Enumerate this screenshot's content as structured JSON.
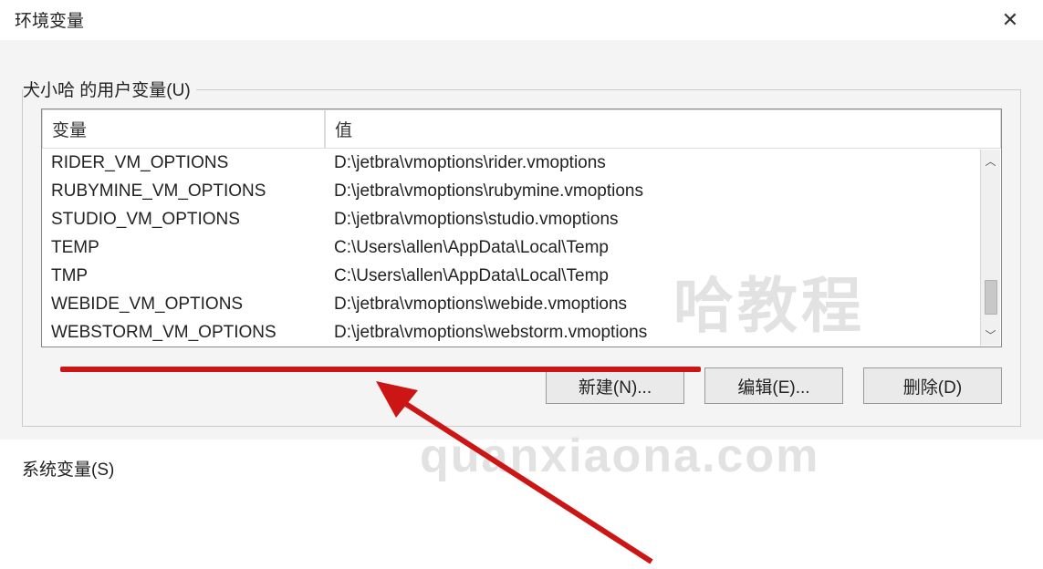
{
  "window": {
    "title": "环境变量"
  },
  "user_vars": {
    "label": "犬小哈 的用户变量(U)",
    "columns": {
      "name": "变量",
      "value": "值"
    },
    "rows": [
      {
        "name": "RIDER_VM_OPTIONS",
        "value": "D:\\jetbra\\vmoptions\\rider.vmoptions"
      },
      {
        "name": "RUBYMINE_VM_OPTIONS",
        "value": "D:\\jetbra\\vmoptions\\rubymine.vmoptions"
      },
      {
        "name": "STUDIO_VM_OPTIONS",
        "value": "D:\\jetbra\\vmoptions\\studio.vmoptions"
      },
      {
        "name": "TEMP",
        "value": "C:\\Users\\allen\\AppData\\Local\\Temp"
      },
      {
        "name": "TMP",
        "value": "C:\\Users\\allen\\AppData\\Local\\Temp"
      },
      {
        "name": "WEBIDE_VM_OPTIONS",
        "value": "D:\\jetbra\\vmoptions\\webide.vmoptions"
      },
      {
        "name": "WEBSTORM_VM_OPTIONS",
        "value": "D:\\jetbra\\vmoptions\\webstorm.vmoptions"
      }
    ]
  },
  "buttons": {
    "new": "新建(N)...",
    "edit": "编辑(E)...",
    "delete": "删除(D)"
  },
  "system_vars": {
    "label": "系统变量(S)"
  },
  "watermark": {
    "line1": "哈教程",
    "line2": "quanxiaona.com"
  }
}
